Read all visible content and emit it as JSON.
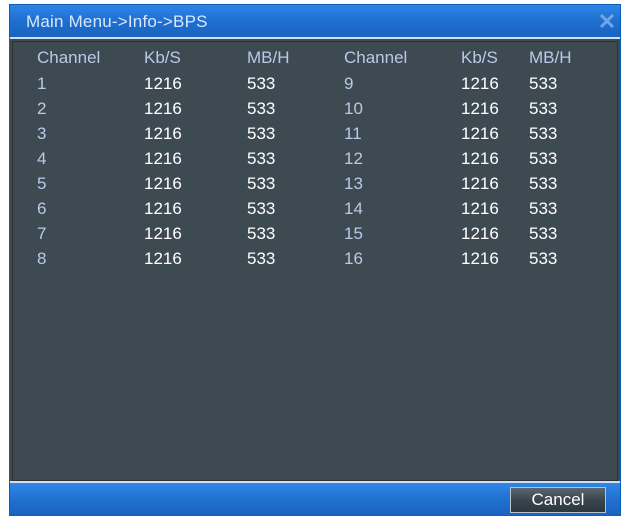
{
  "window": {
    "title": "Main Menu->Info->BPS",
    "close_glyph": "✕"
  },
  "table": {
    "headers": [
      "Channel",
      "Kb/S",
      "MB/H",
      "Channel",
      "Kb/S",
      "MB/H"
    ],
    "rows": [
      {
        "ch1": "1",
        "kb1": "1216",
        "mb1": "533",
        "ch2": "9",
        "kb2": "1216",
        "mb2": "533"
      },
      {
        "ch1": "2",
        "kb1": "1216",
        "mb1": "533",
        "ch2": "10",
        "kb2": "1216",
        "mb2": "533"
      },
      {
        "ch1": "3",
        "kb1": "1216",
        "mb1": "533",
        "ch2": "11",
        "kb2": "1216",
        "mb2": "533"
      },
      {
        "ch1": "4",
        "kb1": "1216",
        "mb1": "533",
        "ch2": "12",
        "kb2": "1216",
        "mb2": "533"
      },
      {
        "ch1": "5",
        "kb1": "1216",
        "mb1": "533",
        "ch2": "13",
        "kb2": "1216",
        "mb2": "533"
      },
      {
        "ch1": "6",
        "kb1": "1216",
        "mb1": "533",
        "ch2": "14",
        "kb2": "1216",
        "mb2": "533"
      },
      {
        "ch1": "7",
        "kb1": "1216",
        "mb1": "533",
        "ch2": "15",
        "kb2": "1216",
        "mb2": "533"
      },
      {
        "ch1": "8",
        "kb1": "1216",
        "mb1": "533",
        "ch2": "16",
        "kb2": "1216",
        "mb2": "533"
      }
    ]
  },
  "footer": {
    "cancel_label": "Cancel"
  },
  "colors": {
    "titlebar": "#1f6fcf",
    "background": "#3e4a52",
    "header_text": "#b9c9e8",
    "value_text": "#ffffff"
  },
  "icons": {
    "close": "close-icon"
  }
}
